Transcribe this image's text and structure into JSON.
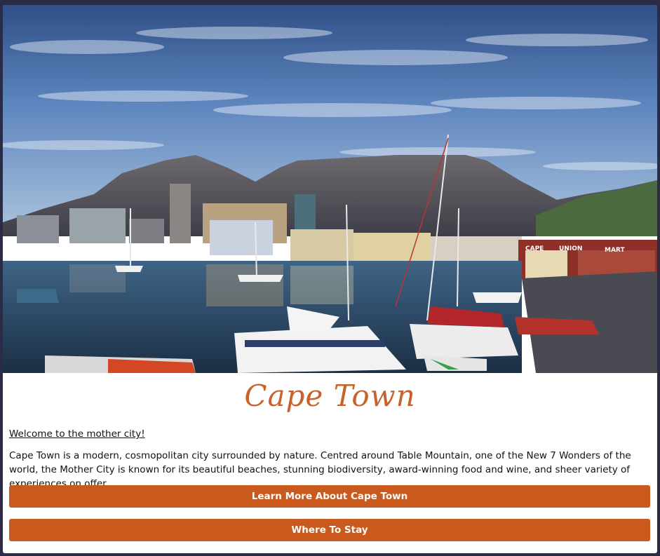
{
  "hero": {
    "image_subject": "Cape Town waterfront harbour with Table Mountain",
    "signs": {
      "cape_union_mart": "CAPE UNION MART"
    }
  },
  "card": {
    "title": "Cape Town",
    "welcome_link": "Welcome to the mother city!",
    "description": "Cape Town is a modern, cosmopolitan city surrounded by nature. Centred around Table Mountain, one of the New 7 Wonders of the world, the Mother City is known for its beautiful beaches, stunning biodiversity, award-winning food and wine, and sheer variety of experiences on offer.",
    "buttons": {
      "learn_more": "Learn More About Cape Town",
      "where_to_stay": "Where To Stay"
    }
  },
  "colors": {
    "accent": "#c9591c",
    "title": "#c8622a",
    "page_background": "#2b2b45"
  }
}
